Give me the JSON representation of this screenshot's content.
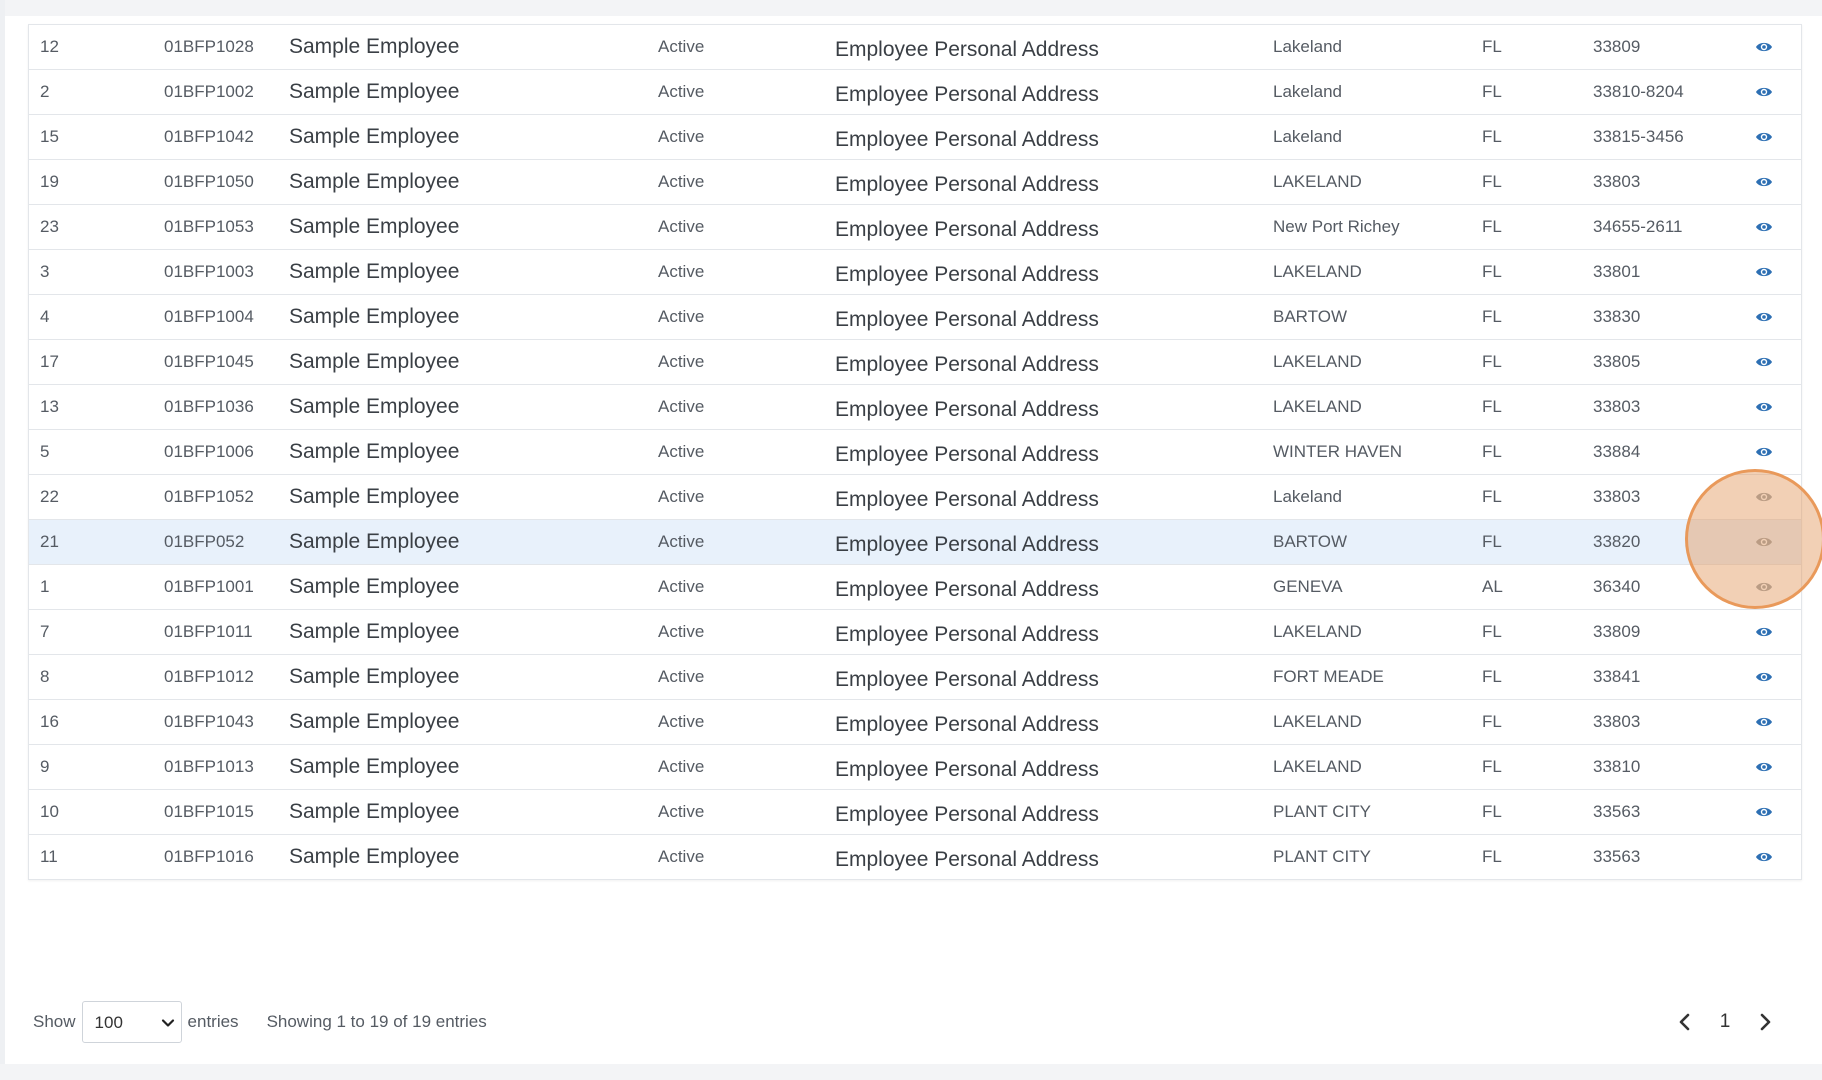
{
  "colors": {
    "eye_active": "#2d6fb3",
    "eye_inactive": "#9aa0a6",
    "highlight_row": "#e8f1fb",
    "focus_ring": "#e8944f"
  },
  "rows": [
    {
      "num": "12",
      "id": "01BFP1028",
      "name": "Sample Employee",
      "status": "Active",
      "address": "Employee Personal Address",
      "city": "Lakeland",
      "state": "FL",
      "zip": "33809",
      "icon": "eye-icon"
    },
    {
      "num": "2",
      "id": "01BFP1002",
      "name": "Sample Employee",
      "status": "Active",
      "address": "Employee Personal Address",
      "city": "Lakeland",
      "state": "FL",
      "zip": "33810-8204",
      "icon": "eye-icon"
    },
    {
      "num": "15",
      "id": "01BFP1042",
      "name": "Sample Employee",
      "status": "Active",
      "address": "Employee Personal Address",
      "city": "Lakeland",
      "state": "FL",
      "zip": "33815-3456",
      "icon": "eye-icon"
    },
    {
      "num": "19",
      "id": "01BFP1050",
      "name": "Sample Employee",
      "status": "Active",
      "address": "Employee Personal Address",
      "city": "LAKELAND",
      "state": "FL",
      "zip": "33803",
      "icon": "eye-icon"
    },
    {
      "num": "23",
      "id": "01BFP1053",
      "name": "Sample Employee",
      "status": "Active",
      "address": "Employee Personal Address",
      "city": "New Port Richey",
      "state": "FL",
      "zip": "34655-2611",
      "icon": "eye-icon"
    },
    {
      "num": "3",
      "id": "01BFP1003",
      "name": "Sample Employee",
      "status": "Active",
      "address": "Employee Personal Address",
      "city": "LAKELAND",
      "state": "FL",
      "zip": "33801",
      "icon": "eye-icon"
    },
    {
      "num": "4",
      "id": "01BFP1004",
      "name": "Sample Employee",
      "status": "Active",
      "address": "Employee Personal Address",
      "city": "BARTOW",
      "state": "FL",
      "zip": "33830",
      "icon": "eye-icon"
    },
    {
      "num": "17",
      "id": "01BFP1045",
      "name": "Sample Employee",
      "status": "Active",
      "address": "Employee Personal Address",
      "city": "LAKELAND",
      "state": "FL",
      "zip": "33805",
      "icon": "eye-icon"
    },
    {
      "num": "13",
      "id": "01BFP1036",
      "name": "Sample Employee",
      "status": "Active",
      "address": "Employee Personal Address",
      "city": "LAKELAND",
      "state": "FL",
      "zip": "33803",
      "icon": "eye-icon"
    },
    {
      "num": "5",
      "id": "01BFP1006",
      "name": "Sample Employee",
      "status": "Active",
      "address": "Employee Personal Address",
      "city": "WINTER HAVEN",
      "state": "FL",
      "zip": "33884",
      "icon": "eye-icon"
    },
    {
      "num": "22",
      "id": "01BFP1052",
      "name": "Sample Employee",
      "status": "Active",
      "address": "Employee Personal Address",
      "city": "Lakeland",
      "state": "FL",
      "zip": "33803",
      "icon": "eye-icon"
    },
    {
      "num": "21",
      "id": "01BFP052",
      "name": "Sample Employee",
      "status": "Active",
      "address": "Employee Personal Address",
      "city": "BARTOW",
      "state": "FL",
      "zip": "33820",
      "icon": "eye-icon"
    },
    {
      "num": "1",
      "id": "01BFP1001",
      "name": "Sample Employee",
      "status": "Active",
      "address": "Employee Personal Address",
      "city": "GENEVA",
      "state": "AL",
      "zip": "36340",
      "icon": "eye-icon"
    },
    {
      "num": "7",
      "id": "01BFP1011",
      "name": "Sample Employee",
      "status": "Active",
      "address": "Employee Personal Address",
      "city": "LAKELAND",
      "state": "FL",
      "zip": "33809",
      "icon": "eye-icon"
    },
    {
      "num": "8",
      "id": "01BFP1012",
      "name": "Sample Employee",
      "status": "Active",
      "address": "Employee Personal Address",
      "city": "FORT MEADE",
      "state": "FL",
      "zip": "33841",
      "icon": "eye-icon"
    },
    {
      "num": "16",
      "id": "01BFP1043",
      "name": "Sample Employee",
      "status": "Active",
      "address": "Employee Personal Address",
      "city": "LAKELAND",
      "state": "FL",
      "zip": "33803",
      "icon": "eye-icon"
    },
    {
      "num": "9",
      "id": "01BFP1013",
      "name": "Sample Employee",
      "status": "Active",
      "address": "Employee Personal Address",
      "city": "LAKELAND",
      "state": "FL",
      "zip": "33810",
      "icon": "eye-icon"
    },
    {
      "num": "10",
      "id": "01BFP1015",
      "name": "Sample Employee",
      "status": "Active",
      "address": "Employee Personal Address",
      "city": "PLANT CITY",
      "state": "FL",
      "zip": "33563",
      "icon": "eye-icon"
    },
    {
      "num": "11",
      "id": "01BFP1016",
      "name": "Sample Employee",
      "status": "Active",
      "address": "Employee Personal Address",
      "city": "PLANT CITY",
      "state": "FL",
      "zip": "33563",
      "icon": "eye-icon"
    }
  ],
  "footer": {
    "show_label": "Show",
    "page_size": "100",
    "entries_label": "entries",
    "info": "Showing 1 to 19 of 19 entries"
  },
  "pagination": {
    "prev_icon": "chevron-left-icon",
    "current_page": "1",
    "next_icon": "chevron-right-icon"
  }
}
